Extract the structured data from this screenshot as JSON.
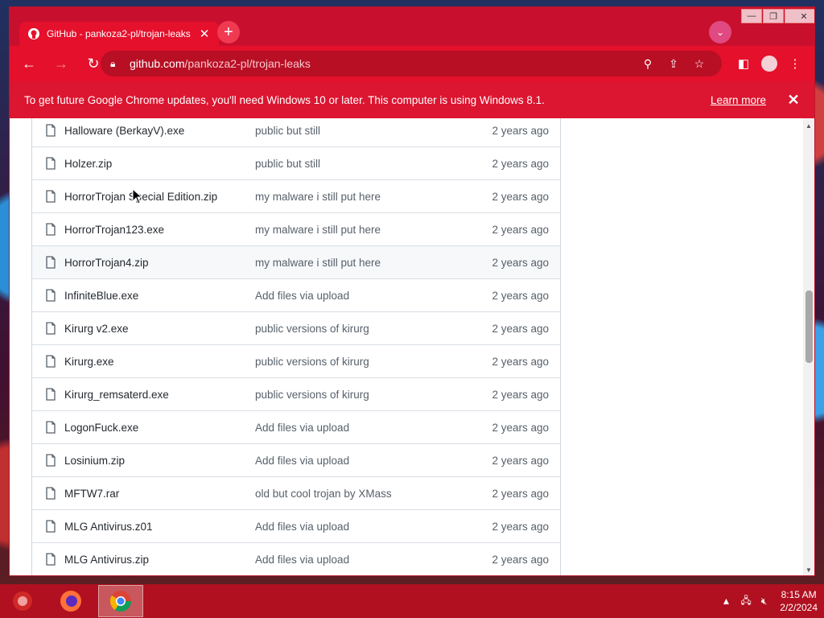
{
  "browser": {
    "tab_title": "GitHub - pankoza2-pl/trojan-leaks",
    "url_host": "github.com",
    "url_path": "/pankoza2-pl/trojan-leaks",
    "accent": "#e5102c"
  },
  "infobar": {
    "message": "To get future Google Chrome updates, you'll need Windows 10 or later. This computer is using Windows 8.1.",
    "learn_more": "Learn more"
  },
  "files": [
    {
      "name": "Halloware (BerkayV).exe",
      "message": "public but still",
      "age": "2 years ago"
    },
    {
      "name": "Holzer.zip",
      "message": "public but still",
      "age": "2 years ago"
    },
    {
      "name": "HorrorTrojan Special Edition.zip",
      "message": "my malware i still put here",
      "age": "2 years ago"
    },
    {
      "name": "HorrorTrojan123.exe",
      "message": "my malware i still put here",
      "age": "2 years ago"
    },
    {
      "name": "HorrorTrojan4.zip",
      "message": "my malware i still put here",
      "age": "2 years ago"
    },
    {
      "name": "InfiniteBlue.exe",
      "message": "Add files via upload",
      "age": "2 years ago"
    },
    {
      "name": "Kirurg v2.exe",
      "message": "public versions of kirurg",
      "age": "2 years ago"
    },
    {
      "name": "Kirurg.exe",
      "message": "public versions of kirurg",
      "age": "2 years ago"
    },
    {
      "name": "Kirurg_remsaterd.exe",
      "message": "public versions of kirurg",
      "age": "2 years ago"
    },
    {
      "name": "LogonFuck.exe",
      "message": "Add files via upload",
      "age": "2 years ago"
    },
    {
      "name": "Losinium.zip",
      "message": "Add files via upload",
      "age": "2 years ago"
    },
    {
      "name": "MFTW7.rar",
      "message": "old but cool trojan by XMass",
      "age": "2 years ago"
    },
    {
      "name": "MLG Antivirus.z01",
      "message": "Add files via upload",
      "age": "2 years ago"
    },
    {
      "name": "MLG Antivirus.zip",
      "message": "Add files via upload",
      "age": "2 years ago"
    }
  ],
  "taskbar": {
    "time": "8:15 AM",
    "date": "2/2/2024"
  }
}
